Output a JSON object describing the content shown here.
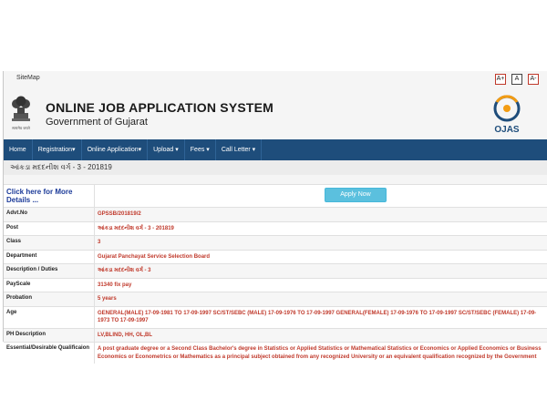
{
  "topbar": {
    "sitemap": "SiteMap",
    "font_buttons": [
      "A+",
      "A",
      "A-"
    ]
  },
  "header": {
    "title": "ONLINE JOB APPLICATION SYSTEM",
    "subtitle": "Government of Gujarat",
    "logo_text": "OJAS",
    "emblem_caption": "सत्यमेव जयते"
  },
  "nav": {
    "items": [
      "Home",
      "Registration▾",
      "Online Application▾",
      "Upload ▾",
      "Fees ▾",
      "Call Letter ▾"
    ]
  },
  "subheading": "આંકડા મદદનીશ વર્ગ - 3 - 201819",
  "details": {
    "more_link": "Click here for More Details ...",
    "apply_button": "Apply Now",
    "rows": [
      {
        "label": "Advt.No",
        "value": "GPSSB/201819/2"
      },
      {
        "label": "Post",
        "value": "આંકડા મદદનીશ વર્ગ - 3 - 201819"
      },
      {
        "label": "Class",
        "value": "3"
      },
      {
        "label": "Department",
        "value": "Gujarat Panchayat Service Selection Board"
      },
      {
        "label": "Description / Duties",
        "value": "આંકડા મદદનીશ વર્ગ - 3"
      },
      {
        "label": "PayScale",
        "value": "31340 fix pay"
      },
      {
        "label": "Probation",
        "value": "5 years"
      },
      {
        "label": "Age",
        "value": "GENERAL(MALE) 17-09-1981 TO 17-09-1997 SC/ST/SEBC (MALE) 17-09-1976 TO 17-09-1997 GENERAL(FEMALE) 17-09-1976 TO 17-09-1997 SC/ST/SEBC (FEMALE) 17-09-1973 TO 17-09-1997"
      },
      {
        "label": "PH Description",
        "value": "LV,BLIND, HH, OL,BL"
      },
      {
        "label": "Essential/Desirable Qualificaion",
        "value": "A post graduate degree or a Second Class Bachelor's degree in Statistics or Applied Statistics or Mathematical Statistics or Economics or Applied Economics or Business Economics or Econometrics or Mathematics as a principal subject obtained from any recognized University or an equivalent qualification recognized by the Government"
      }
    ]
  },
  "colors": {
    "navbar": "#1e4d7b",
    "value_text": "#c0392b",
    "link": "#1c3b99",
    "button": "#5bc0de"
  }
}
